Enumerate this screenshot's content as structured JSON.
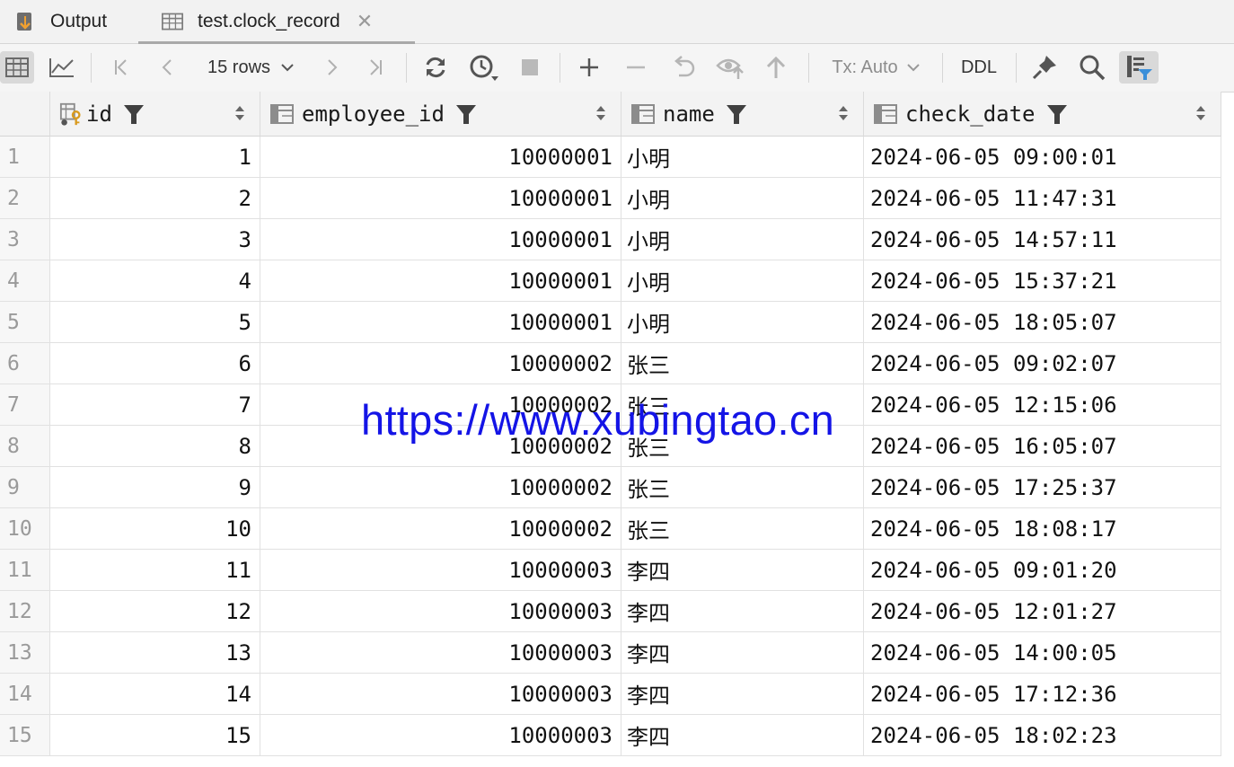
{
  "tabs": [
    {
      "label": "Output",
      "icon": "output-icon"
    },
    {
      "label": "test.clock_record",
      "icon": "table-icon",
      "active": true
    }
  ],
  "toolbar": {
    "rows_label": "15 rows",
    "tx_label": "Tx: Auto",
    "ddl_label": "DDL"
  },
  "columns": [
    {
      "name": "id",
      "icon": "primary-key-column-icon"
    },
    {
      "name": "employee_id",
      "icon": "column-icon"
    },
    {
      "name": "name",
      "icon": "column-icon"
    },
    {
      "name": "check_date",
      "icon": "column-icon"
    }
  ],
  "rows": [
    {
      "num": "1",
      "id": "1",
      "employee_id": "10000001",
      "name": "小明",
      "check_date": "2024-06-05 09:00:01"
    },
    {
      "num": "2",
      "id": "2",
      "employee_id": "10000001",
      "name": "小明",
      "check_date": "2024-06-05 11:47:31"
    },
    {
      "num": "3",
      "id": "3",
      "employee_id": "10000001",
      "name": "小明",
      "check_date": "2024-06-05 14:57:11"
    },
    {
      "num": "4",
      "id": "4",
      "employee_id": "10000001",
      "name": "小明",
      "check_date": "2024-06-05 15:37:21"
    },
    {
      "num": "5",
      "id": "5",
      "employee_id": "10000001",
      "name": "小明",
      "check_date": "2024-06-05 18:05:07"
    },
    {
      "num": "6",
      "id": "6",
      "employee_id": "10000002",
      "name": "张三",
      "check_date": "2024-06-05 09:02:07"
    },
    {
      "num": "7",
      "id": "7",
      "employee_id": "10000002",
      "name": "张三",
      "check_date": "2024-06-05 12:15:06"
    },
    {
      "num": "8",
      "id": "8",
      "employee_id": "10000002",
      "name": "张三",
      "check_date": "2024-06-05 16:05:07"
    },
    {
      "num": "9",
      "id": "9",
      "employee_id": "10000002",
      "name": "张三",
      "check_date": "2024-06-05 17:25:37"
    },
    {
      "num": "10",
      "id": "10",
      "employee_id": "10000002",
      "name": "张三",
      "check_date": "2024-06-05 18:08:17"
    },
    {
      "num": "11",
      "id": "11",
      "employee_id": "10000003",
      "name": "李四",
      "check_date": "2024-06-05 09:01:20"
    },
    {
      "num": "12",
      "id": "12",
      "employee_id": "10000003",
      "name": "李四",
      "check_date": "2024-06-05 12:01:27"
    },
    {
      "num": "13",
      "id": "13",
      "employee_id": "10000003",
      "name": "李四",
      "check_date": "2024-06-05 14:00:05"
    },
    {
      "num": "14",
      "id": "14",
      "employee_id": "10000003",
      "name": "李四",
      "check_date": "2024-06-05 17:12:36"
    },
    {
      "num": "15",
      "id": "15",
      "employee_id": "10000003",
      "name": "李四",
      "check_date": "2024-06-05 18:02:23"
    }
  ],
  "watermark": "https://www.xubingtao.cn",
  "colors": {
    "watermark": "#1414e6",
    "toolbar_bg": "#f5f5f5",
    "header_bg": "#f3f3f3"
  }
}
